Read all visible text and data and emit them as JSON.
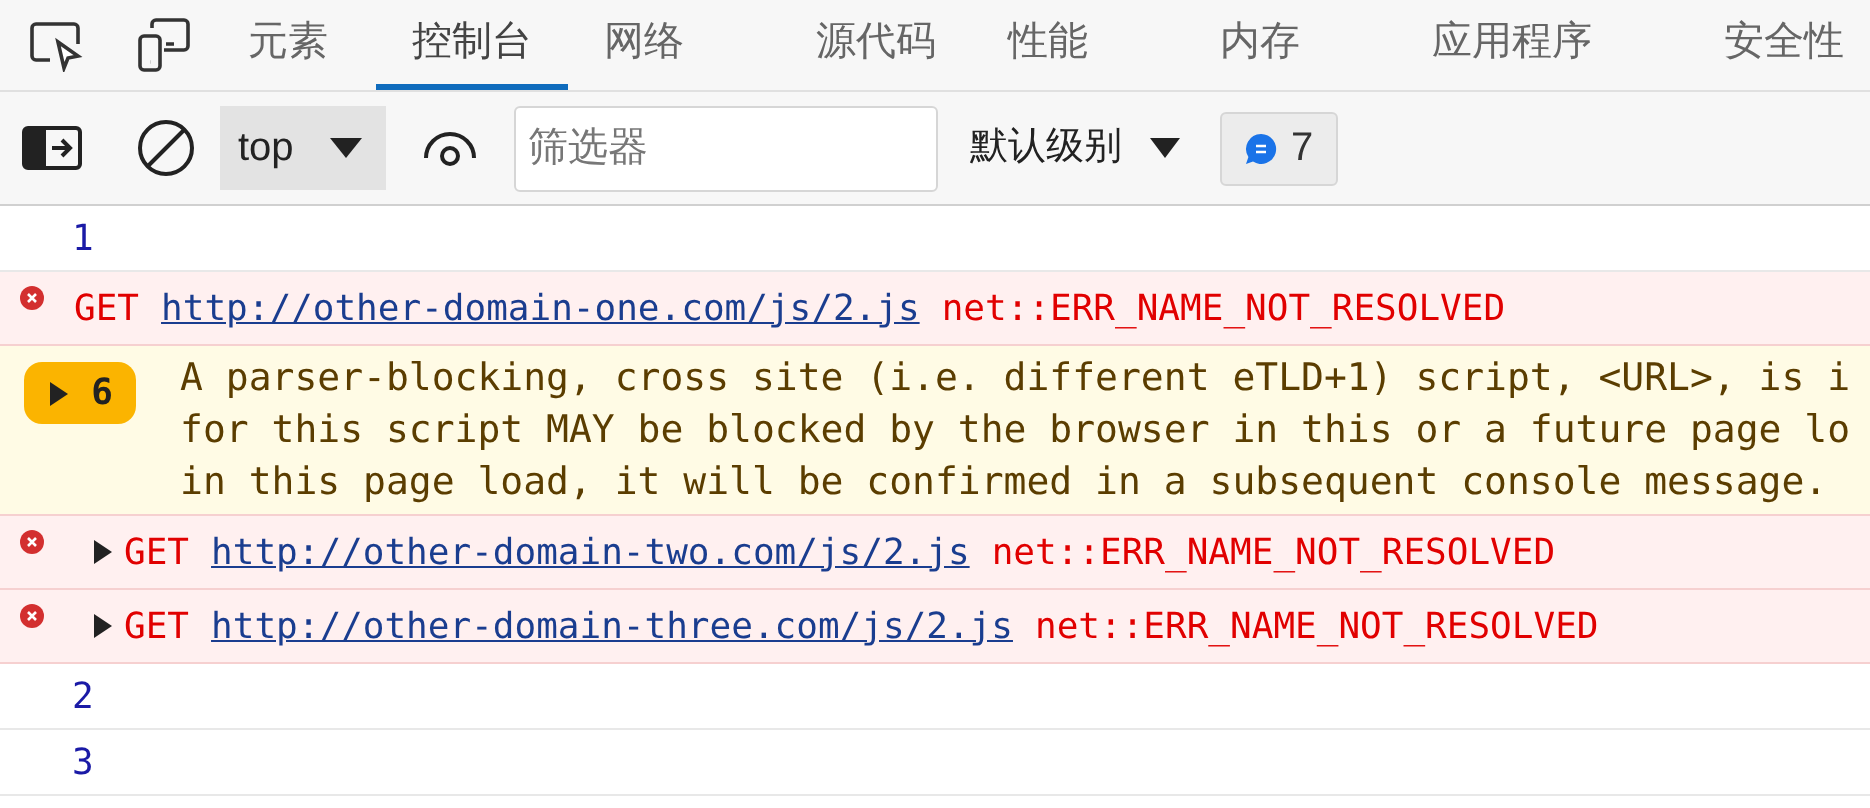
{
  "tabs": [
    {
      "label": "元素",
      "selected": false
    },
    {
      "label": "控制台",
      "selected": true
    },
    {
      "label": "网络",
      "selected": false
    },
    {
      "label": "源代码",
      "selected": false
    },
    {
      "label": "性能",
      "selected": false
    },
    {
      "label": "内存",
      "selected": false
    },
    {
      "label": "应用程序",
      "selected": false
    },
    {
      "label": "安全性",
      "selected": false
    }
  ],
  "toolbar": {
    "context": "top",
    "filter": {
      "placeholder": "筛选器"
    },
    "level": "默认级别",
    "message_count": "7"
  },
  "messages": [
    {
      "kind": "log",
      "text": "1"
    },
    {
      "kind": "error",
      "expandable": false,
      "method": "GET",
      "url": "http://other-domain-one.com/js/2.js",
      "error": "net::ERR_NAME_NOT_RESOLVED"
    },
    {
      "kind": "warning",
      "count": "6",
      "lines": [
        "A parser-blocking, cross site (i.e. different eTLD+1) script, <URL>, is i",
        "for this script MAY be blocked by the browser in this or a future page lo",
        "in this page load, it will be confirmed in a subsequent console message."
      ]
    },
    {
      "kind": "error",
      "expandable": true,
      "method": "GET",
      "url": "http://other-domain-two.com/js/2.js",
      "error": "net::ERR_NAME_NOT_RESOLVED"
    },
    {
      "kind": "error",
      "expandable": true,
      "method": "GET",
      "url": "http://other-domain-three.com/js/2.js",
      "error": "net::ERR_NAME_NOT_RESOLVED"
    },
    {
      "kind": "log",
      "text": "2"
    },
    {
      "kind": "log",
      "text": "3"
    }
  ]
}
